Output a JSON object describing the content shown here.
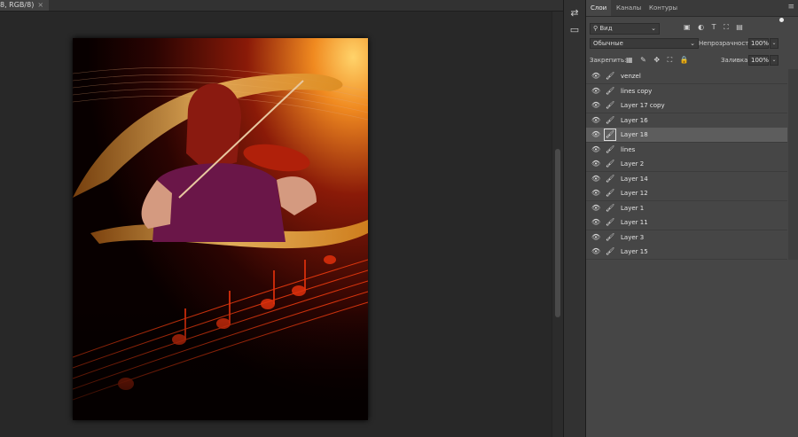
{
  "document": {
    "tab_label": "8, RGB/8)",
    "close_glyph": "×"
  },
  "tools": [
    {
      "icon": "history-brush-icon",
      "glyph": "⇄"
    },
    {
      "icon": "comment-icon",
      "glyph": "▭"
    }
  ],
  "panel": {
    "tabs": [
      {
        "label": "Слои",
        "active": true
      },
      {
        "label": "Каналы",
        "active": false
      },
      {
        "label": "Контуры",
        "active": false
      }
    ],
    "menu_glyph": "≡",
    "filter": {
      "value": "Вид",
      "search_glyph": "⚲",
      "chevron": "⌄",
      "icons": [
        {
          "name": "pixel-filter-icon",
          "glyph": "▣"
        },
        {
          "name": "adjustment-filter-icon",
          "glyph": "◐"
        },
        {
          "name": "type-filter-icon",
          "glyph": "T"
        },
        {
          "name": "shape-filter-icon",
          "glyph": "⛶"
        },
        {
          "name": "smart-object-filter-icon",
          "glyph": "▤"
        }
      ]
    },
    "blend_mode": "Обычные",
    "opacity_label": "Непрозрачность:",
    "opacity_value": "100%",
    "lock_label": "Закрепить:",
    "lock_icons": [
      {
        "name": "lock-pixels-icon",
        "glyph": "▦"
      },
      {
        "name": "lock-paint-icon",
        "glyph": "✎"
      },
      {
        "name": "lock-position-icon",
        "glyph": "✥"
      },
      {
        "name": "lock-artboard-icon",
        "glyph": "⛶"
      },
      {
        "name": "lock-all-icon",
        "glyph": "🔒"
      }
    ],
    "fill_label": "Заливка:",
    "fill_value": "100%",
    "layers": [
      {
        "name": "venzel",
        "selected": false
      },
      {
        "name": "lines copy",
        "selected": false
      },
      {
        "name": "Layer 17 copy",
        "selected": false
      },
      {
        "name": "Layer 16",
        "selected": false
      },
      {
        "name": "Layer 18",
        "selected": true
      },
      {
        "name": "lines",
        "selected": false
      },
      {
        "name": "Layer 2",
        "selected": false
      },
      {
        "name": "Layer 14",
        "selected": false
      },
      {
        "name": "Layer 12",
        "selected": false
      },
      {
        "name": "Layer 1",
        "selected": false
      },
      {
        "name": "Layer 11",
        "selected": false
      },
      {
        "name": "Layer 3",
        "selected": false
      },
      {
        "name": "Layer 15",
        "selected": false
      }
    ],
    "eye_glyph": "👁",
    "brush_glyph": "🖌"
  }
}
